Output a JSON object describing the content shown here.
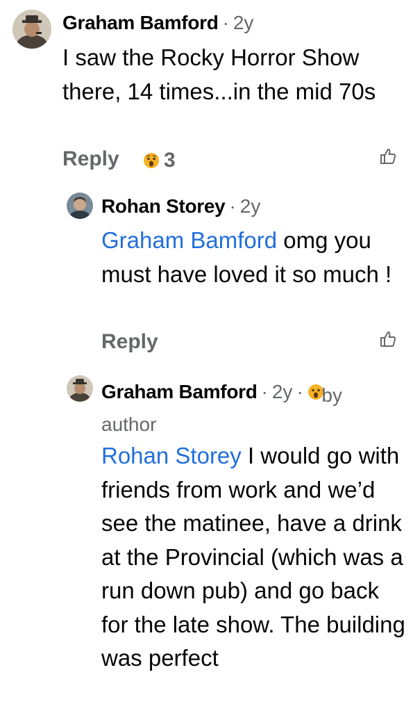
{
  "comments": [
    {
      "author": "Graham Bamford",
      "time": "2y",
      "text": "I saw the Rocky Horror Show there, 14 times...in the mid 70s",
      "reply_label": "Reply",
      "reaction": {
        "icon": "wow-emoji",
        "count": "3"
      }
    },
    {
      "author": "Rohan Storey",
      "time": "2y",
      "mention": "Graham Bamford",
      "text": " omg you must have loved it so much !",
      "reply_label": "Reply"
    },
    {
      "author": "Graham Bamford",
      "time": "2y",
      "badge_icon": "wow-emoji",
      "badge_text": "by author",
      "mention": "Rohan Storey",
      "text": " I would go with friends from work and we’d see the matinee, have a drink at the Provincial (which was a run down pub) and go back for the late show. The building was perfect"
    }
  ],
  "icons": {
    "like": "thumbs-up-outline-icon",
    "wow": "wow-emoji"
  },
  "colors": {
    "mention": "#216fdb",
    "secondary_text": "#65676b",
    "primary_text": "#050505"
  }
}
